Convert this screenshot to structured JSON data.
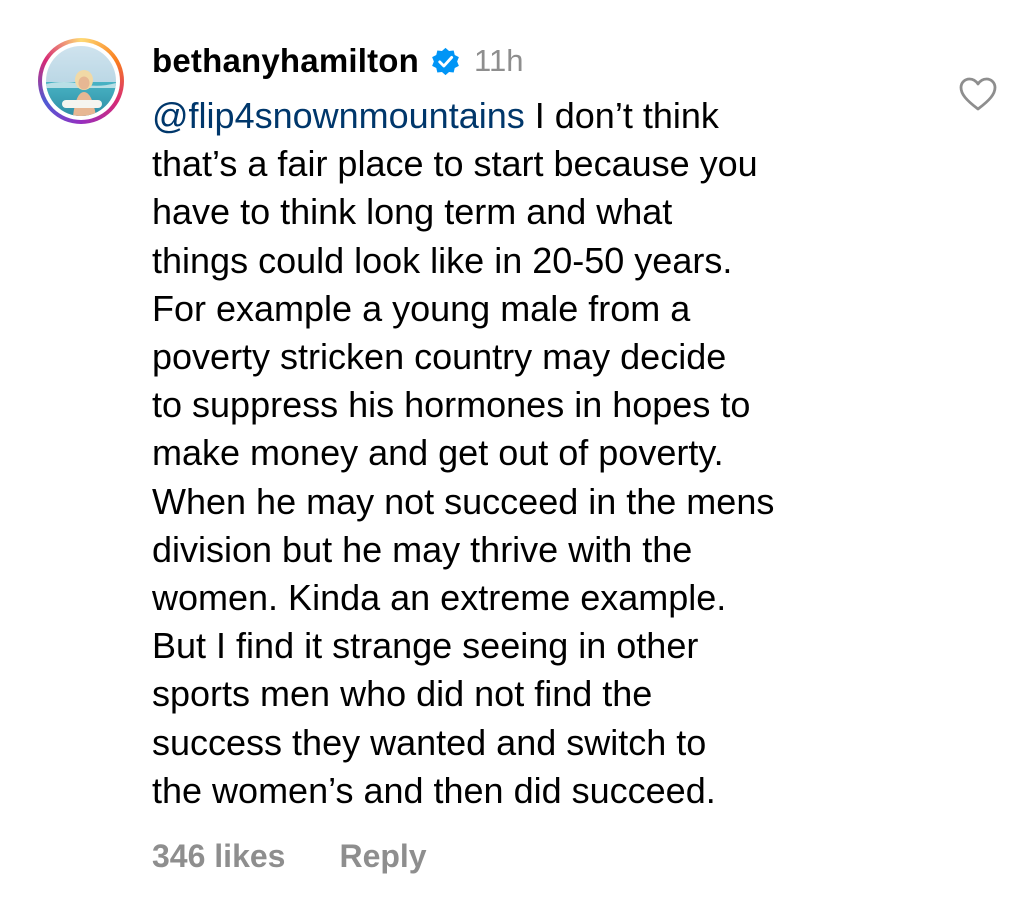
{
  "comment": {
    "username": "bethanyhamilton",
    "verified_icon": "verified-badge-icon",
    "timestamp": "11h",
    "mention": "@flip4snownmountains",
    "text_after_mention": " I don’t think\nthat’s a fair place to start because you\nhave to think long term and what\nthings could look like in 20-50 years.\nFor example a young male from a\npoverty stricken country may decide\nto suppress his hormones in hopes to\nmake money and get out of poverty.\nWhen he may not succeed in the mens\ndivision but he may thrive with the\nwomen. Kinda an extreme example.\nBut I find it strange seeing in other\nsports men who did not find the\nsuccess they wanted and switch to\nthe women’s and then did succeed.",
    "likes": "346 likes",
    "reply_label": "Reply",
    "like_icon": "heart-outline-icon"
  },
  "colors": {
    "mention": "#00376b",
    "secondary_text": "#8e8e8e",
    "verified_blue": "#0095f6"
  }
}
